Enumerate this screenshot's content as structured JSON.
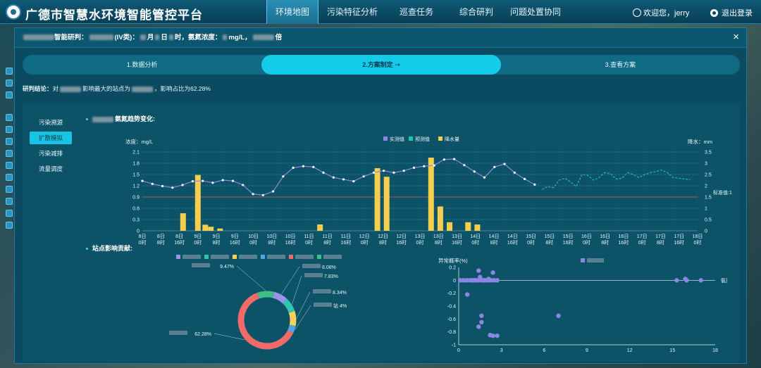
{
  "header": {
    "title": "广德市智慧水环境智能管控平台",
    "nav": [
      {
        "label": "环境地图",
        "active": true
      },
      {
        "label": "污染特征分析",
        "active": false
      },
      {
        "label": "巡查任务",
        "active": false
      },
      {
        "label": "综合研判",
        "active": false
      },
      {
        "label": "问题处置协同",
        "active": false
      }
    ],
    "user_label": "欢迎您，jerry",
    "logout_label": "退出登录"
  },
  "modal": {
    "title_parts": {
      "prefix": "智能研判：",
      "class_text": "(IV类)：",
      "month": "月",
      "day": "日",
      "hour": "时，",
      "ammonia": "氨氮浓度：",
      "unit": "mg/L，",
      "times": "倍"
    },
    "close_label": "×",
    "steps": [
      {
        "label": "1.数据分析",
        "active": false
      },
      {
        "label": "2.方案制定 ⇢",
        "active": true
      },
      {
        "label": "3.查看方案",
        "active": false
      }
    ],
    "conclusion": {
      "label": "研判结论：",
      "text1": "对",
      "text2": "影响最大的站点为",
      "text3": "，影响占比为62.28%"
    },
    "side_menu": [
      {
        "label": "污染溯源",
        "active": false
      },
      {
        "label": "扩散模拟",
        "active": true
      },
      {
        "label": "污染减排",
        "active": false
      },
      {
        "label": "流量调度",
        "active": false
      }
    ],
    "trend_title": "氨氮趋势变化:",
    "contrib_title": "站点影响贡献:"
  },
  "chart_data": [
    {
      "type": "bar+line",
      "title": "氨氮趋势变化:",
      "legend": [
        "实测值",
        "预测值",
        "降水量"
      ],
      "ylabel_left": "浓度：mg/L",
      "ylabel_right": "降水：mm",
      "ylim_left": [
        0,
        2.1
      ],
      "ylim_right": [
        0,
        3.5
      ],
      "yticks_left": [
        "0",
        "0.3",
        "0.6",
        "0.9",
        "1.2",
        "1.5",
        "1.8",
        "2.1"
      ],
      "yticks_right": [
        "0",
        "0.5",
        "1",
        "1.5",
        "2",
        "2.5",
        "3",
        "3.5"
      ],
      "xticks": [
        [
          "8日",
          "0时"
        ],
        [
          "8日",
          "8时"
        ],
        [
          "8日",
          "16时"
        ],
        [
          "9日",
          "0时"
        ],
        [
          "9日",
          "8时"
        ],
        [
          "9日",
          "16时"
        ],
        [
          "10日",
          "0时"
        ],
        [
          "10日",
          "8时"
        ],
        [
          "10日",
          "16时"
        ],
        [
          "11日",
          "0时"
        ],
        [
          "11日",
          "8时"
        ],
        [
          "11日",
          "16时"
        ],
        [
          "12日",
          "0时"
        ],
        [
          "12日",
          "8时"
        ],
        [
          "12日",
          "16时"
        ],
        [
          "13日",
          "0时"
        ],
        [
          "13日",
          "8时"
        ],
        [
          "13日",
          "16时"
        ],
        [
          "14日",
          "0时"
        ],
        [
          "14日",
          "8时"
        ],
        [
          "14日",
          "16时"
        ],
        [
          "15日",
          "0时"
        ],
        [
          "15日",
          "8时"
        ],
        [
          "15日",
          "16时"
        ],
        [
          "16日",
          "0时"
        ],
        [
          "16日",
          "8时"
        ],
        [
          "16日",
          "16时"
        ],
        [
          "17日",
          "0时"
        ],
        [
          "17日",
          "8时"
        ],
        [
          "17日",
          "16时"
        ],
        [
          "18日",
          "0时"
        ]
      ],
      "standard_label": "标准值:1",
      "standard_value": 0.9,
      "measured": [
        1.33,
        1.25,
        1.19,
        1.15,
        1.22,
        1.32,
        1.33,
        1.28,
        1.35,
        1.33,
        1.22,
        0.98,
        0.95,
        1.05,
        1.45,
        1.68,
        1.72,
        1.7,
        1.55,
        1.42,
        1.37,
        1.32,
        1.45,
        1.55,
        1.6,
        1.55,
        1.6,
        1.68,
        1.72,
        1.74,
        1.9,
        1.91,
        1.75,
        1.58,
        1.42,
        1.7,
        1.78,
        1.55,
        1.38,
        1.23
      ],
      "predicted": [
        1.1,
        1.18,
        1.15,
        1.35,
        1.4,
        1.3,
        1.18,
        1.5,
        1.48,
        1.35,
        1.42,
        1.55,
        1.52,
        1.38,
        1.4,
        1.55,
        1.5,
        1.42,
        1.5,
        1.55,
        1.58,
        1.62,
        1.55,
        1.42,
        1.4,
        1.38,
        1.36
      ],
      "rainfall_bars": [
        {
          "x": 2.2,
          "value": 0.78
        },
        {
          "x": 3.0,
          "value": 2.48
        },
        {
          "x": 3.4,
          "value": 0.27
        },
        {
          "x": 3.7,
          "value": 0.18
        },
        {
          "x": 4.2,
          "value": 0.1
        },
        {
          "x": 9.6,
          "value": 0.28
        },
        {
          "x": 12.7,
          "value": 2.78
        },
        {
          "x": 13.2,
          "value": 2.4
        },
        {
          "x": 15.6,
          "value": 3.25
        },
        {
          "x": 16.1,
          "value": 1.08
        },
        {
          "x": 16.6,
          "value": 0.38
        },
        {
          "x": 17.6,
          "value": 0.38
        },
        {
          "x": 18.1,
          "value": 0.28
        }
      ]
    },
    {
      "type": "pie",
      "slices": [
        {
          "value": 62.28,
          "label": "62.28%",
          "color": "#f06a6a"
        },
        {
          "value": 9.47,
          "label": "9.47%",
          "color": "#3dbf86"
        },
        {
          "value": 8.08,
          "label": "8.08%",
          "color": "#9b93e8"
        },
        {
          "value": 7.83,
          "label": "7.83%",
          "color": "#2ec6b0"
        },
        {
          "value": 8.34,
          "label": "8.34%",
          "color": "#f5d05a"
        },
        {
          "value": 4.0,
          "label": "站 4%",
          "color": "#52a6e6"
        }
      ],
      "legend_colors": [
        "#9b93e8",
        "#2ec6b0",
        "#f5d05a",
        "#52a6e6",
        "#f06a6a",
        "#3dbf86"
      ]
    },
    {
      "type": "scatter",
      "ylabel": "异常概率(%)",
      "series_name": "氨氮",
      "xlim": [
        0,
        18
      ],
      "ylim": [
        -1,
        0.2
      ],
      "xticks": [
        "0",
        "3",
        "6",
        "9",
        "12",
        "15",
        "18"
      ],
      "yticks": [
        "0.2",
        "0",
        "-0.2",
        "-0.4",
        "-0.6",
        "-0.8",
        "-1"
      ],
      "points": [
        [
          0.1,
          0
        ],
        [
          0.3,
          0
        ],
        [
          0.5,
          0
        ],
        [
          0.6,
          0
        ],
        [
          0.8,
          0
        ],
        [
          0.9,
          0
        ],
        [
          1.0,
          0
        ],
        [
          1.1,
          0
        ],
        [
          1.2,
          0
        ],
        [
          1.3,
          0
        ],
        [
          1.4,
          0
        ],
        [
          1.5,
          0.05
        ],
        [
          1.6,
          0
        ],
        [
          1.7,
          0
        ],
        [
          1.8,
          0
        ],
        [
          1.9,
          0
        ],
        [
          2.0,
          0
        ],
        [
          2.1,
          0.02
        ],
        [
          2.2,
          0
        ],
        [
          2.3,
          0
        ],
        [
          2.5,
          0
        ],
        [
          2.7,
          0
        ],
        [
          1.4,
          0.15
        ],
        [
          2.4,
          0.12
        ],
        [
          0.6,
          -0.22
        ],
        [
          1.6,
          -0.55
        ],
        [
          1.6,
          -0.65
        ],
        [
          1.4,
          -0.72
        ],
        [
          2.2,
          -0.85
        ],
        [
          2.4,
          -0.86
        ],
        [
          2.7,
          -0.86
        ],
        [
          7.0,
          -0.55
        ],
        [
          15.3,
          0
        ],
        [
          15.9,
          0.02
        ],
        [
          16.0,
          0
        ],
        [
          17.0,
          0
        ]
      ]
    }
  ]
}
